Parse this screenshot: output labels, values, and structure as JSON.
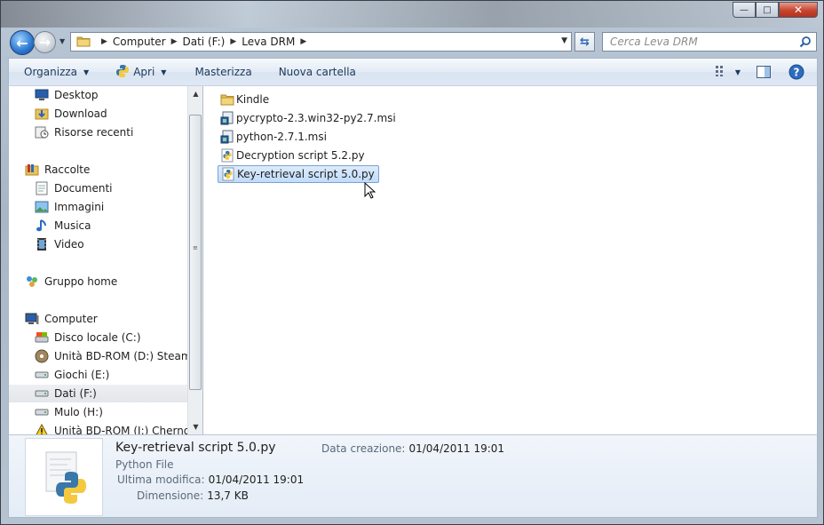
{
  "window": {
    "buttons": {
      "minimize": "—",
      "maximize": "□",
      "close": "✕"
    }
  },
  "address_bar": {
    "crumbs": [
      "Computer",
      "Dati (F:)",
      "Leva DRM"
    ]
  },
  "search": {
    "placeholder": "Cerca Leva DRM"
  },
  "toolbar": {
    "organize": "Organizza",
    "open": "Apri",
    "burn": "Masterizza",
    "new_folder": "Nuova cartella"
  },
  "nav": {
    "items": [
      {
        "label": "Desktop",
        "icon": "desktop-icon"
      },
      {
        "label": "Download",
        "icon": "download-folder-icon"
      },
      {
        "label": "Risorse recenti",
        "icon": "recent-places-icon"
      },
      {
        "label": "Raccolte",
        "icon": "libraries-icon"
      },
      {
        "label": "Documenti",
        "icon": "documents-icon"
      },
      {
        "label": "Immagini",
        "icon": "pictures-icon"
      },
      {
        "label": "Musica",
        "icon": "music-icon"
      },
      {
        "label": "Video",
        "icon": "video-icon"
      },
      {
        "label": "Gruppo home",
        "icon": "homegroup-icon"
      },
      {
        "label": "Computer",
        "icon": "computer-icon"
      },
      {
        "label": "Disco locale (C:)",
        "icon": "local-disk-icon"
      },
      {
        "label": "Unità BD-ROM (D:) Steam Slu",
        "icon": "bd-rom-icon"
      },
      {
        "label": "Giochi (E:)",
        "icon": "drive-icon"
      },
      {
        "label": "Dati (F:)",
        "icon": "drive-icon"
      },
      {
        "label": "Mulo (H:)",
        "icon": "drive-icon"
      },
      {
        "label": "Unità BD-ROM (I:) Chernoby",
        "icon": "bd-rom-warning-icon"
      }
    ]
  },
  "files": [
    {
      "name": "Kindle",
      "icon": "folder-icon"
    },
    {
      "name": "pycrypto-2.3.win32-py2.7.msi",
      "icon": "msi-installer-icon"
    },
    {
      "name": "python-2.7.1.msi",
      "icon": "msi-installer-icon"
    },
    {
      "name": "Decryption script 5.2.py",
      "icon": "python-file-icon"
    },
    {
      "name": "Key-retrieval script 5.0.py",
      "icon": "python-file-icon",
      "selected": true
    }
  ],
  "details": {
    "name": "Key-retrieval script 5.0.py",
    "type": "Python File",
    "modified_label": "Ultima modifica:",
    "modified_value": "01/04/2011 19:01",
    "size_label": "Dimensione:",
    "size_value": "13,7 KB",
    "created_label": "Data creazione:",
    "created_value": "01/04/2011 19:01"
  },
  "colors": {
    "selection_bg": "#c1dcfc",
    "selection_border": "#7da2ce",
    "toolbar_text": "#1e395b",
    "close_button": "#c7452f"
  }
}
